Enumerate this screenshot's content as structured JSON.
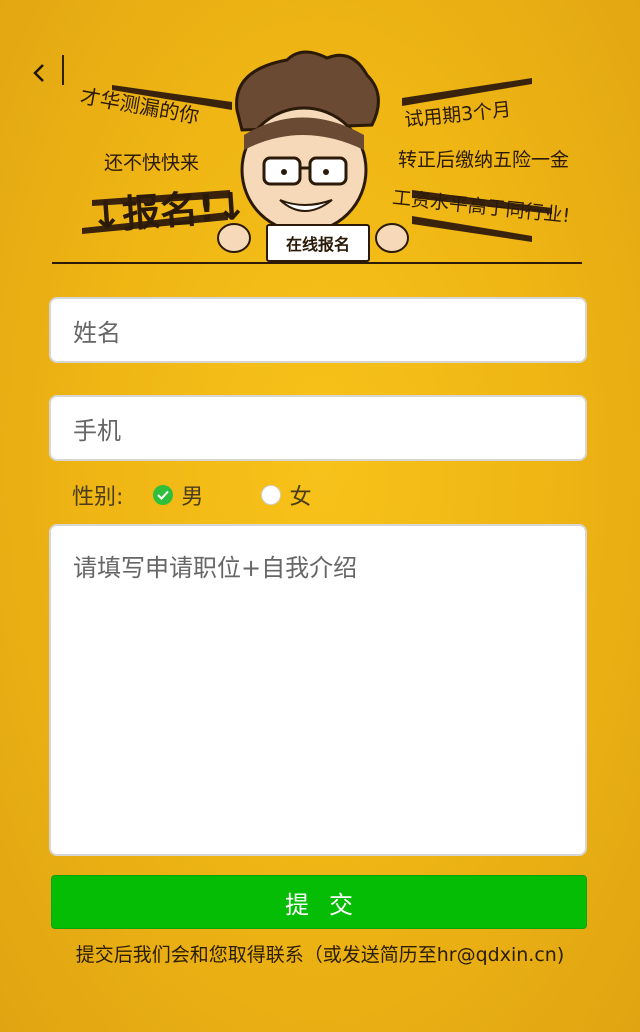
{
  "nav": {
    "back_icon": "chevron-left-icon"
  },
  "banner": {
    "left_line1": "才华测漏的你",
    "left_line2": "还不快快来",
    "left_line3": "↓报名!↓",
    "right_line1": "试用期3个月",
    "right_line2": "转正后缴纳五险一金",
    "right_line3": "工资水平高于同行业!",
    "sign_text": "在线报名"
  },
  "form": {
    "name_placeholder": "姓名",
    "phone_placeholder": "手机",
    "gender_label": "性别:",
    "gender_options": [
      {
        "label": "男",
        "checked": true
      },
      {
        "label": "女",
        "checked": false
      }
    ],
    "intro_placeholder": "请填写申请职位+自我介绍",
    "submit_label": "提交"
  },
  "footer": {
    "note": "提交后我们会和您取得联系（或发送简历至hr@qdxin.cn)"
  },
  "colors": {
    "background": "#f0b714",
    "submit": "#06bd05",
    "check": "#2fbf3a"
  }
}
